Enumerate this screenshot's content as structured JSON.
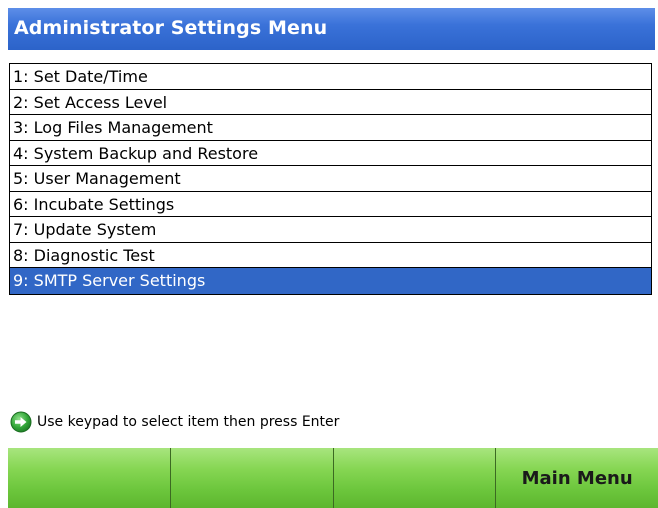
{
  "title": "Administrator Settings Menu",
  "menu": {
    "items": [
      {
        "label": "1: Set Date/Time",
        "selected": false
      },
      {
        "label": "2: Set Access Level",
        "selected": false
      },
      {
        "label": "3: Log Files Management",
        "selected": false
      },
      {
        "label": "4: System Backup and Restore",
        "selected": false
      },
      {
        "label": "5: User Management",
        "selected": false
      },
      {
        "label": "6: Incubate Settings",
        "selected": false
      },
      {
        "label": "7: Update System",
        "selected": false
      },
      {
        "label": "8: Diagnostic Test",
        "selected": false
      },
      {
        "label": "9: SMTP Server Settings",
        "selected": true
      }
    ]
  },
  "status": {
    "icon": "arrow-right-circle-icon",
    "text": "Use keypad to select item then press Enter"
  },
  "softkeys": [
    {
      "label": ""
    },
    {
      "label": ""
    },
    {
      "label": ""
    },
    {
      "label": "Main Menu"
    }
  ],
  "colors": {
    "title_bar": "#3a72d9",
    "selection": "#3167c6",
    "softkey": "#86d653",
    "icon": "#2e9e3a"
  }
}
